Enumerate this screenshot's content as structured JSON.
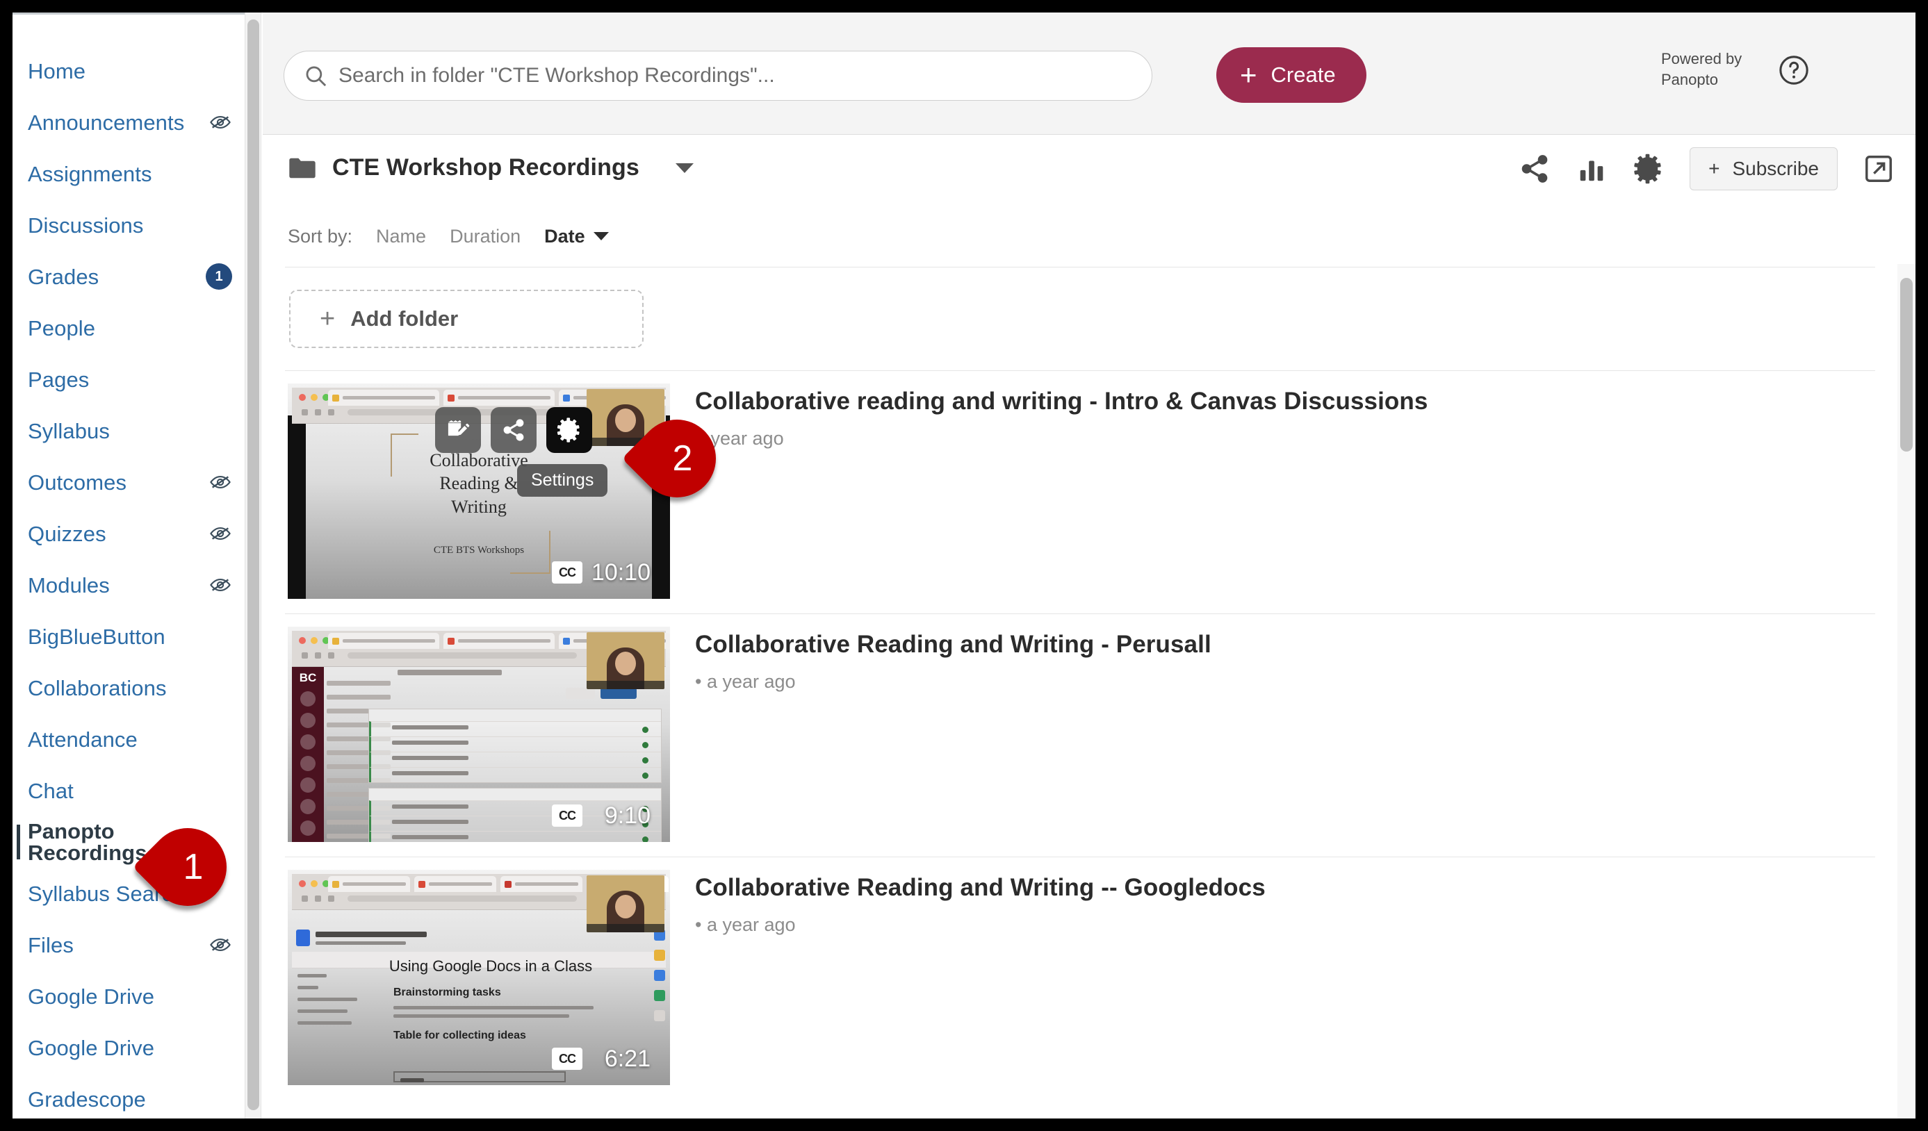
{
  "sidebar": {
    "items": [
      {
        "label": "Home",
        "hidden_icon": false,
        "badge": null,
        "active": false
      },
      {
        "label": "Announcements",
        "hidden_icon": true,
        "badge": null,
        "active": false
      },
      {
        "label": "Assignments",
        "hidden_icon": false,
        "badge": null,
        "active": false
      },
      {
        "label": "Discussions",
        "hidden_icon": false,
        "badge": null,
        "active": false
      },
      {
        "label": "Grades",
        "hidden_icon": false,
        "badge": "1",
        "active": false
      },
      {
        "label": "People",
        "hidden_icon": false,
        "badge": null,
        "active": false
      },
      {
        "label": "Pages",
        "hidden_icon": false,
        "badge": null,
        "active": false
      },
      {
        "label": "Syllabus",
        "hidden_icon": false,
        "badge": null,
        "active": false
      },
      {
        "label": "Outcomes",
        "hidden_icon": true,
        "badge": null,
        "active": false
      },
      {
        "label": "Quizzes",
        "hidden_icon": true,
        "badge": null,
        "active": false
      },
      {
        "label": "Modules",
        "hidden_icon": true,
        "badge": null,
        "active": false
      },
      {
        "label": "BigBlueButton",
        "hidden_icon": false,
        "badge": null,
        "active": false
      },
      {
        "label": "Collaborations",
        "hidden_icon": false,
        "badge": null,
        "active": false
      },
      {
        "label": "Attendance",
        "hidden_icon": false,
        "badge": null,
        "active": false
      },
      {
        "label": "Chat",
        "hidden_icon": false,
        "badge": null,
        "active": false
      },
      {
        "label": "Panopto Recordings",
        "hidden_icon": false,
        "badge": null,
        "active": true
      },
      {
        "label": "Syllabus Search",
        "hidden_icon": false,
        "badge": null,
        "active": false
      },
      {
        "label": "Files",
        "hidden_icon": true,
        "badge": null,
        "active": false
      },
      {
        "label": "Google Drive",
        "hidden_icon": false,
        "badge": null,
        "active": false
      },
      {
        "label": "Google Drive",
        "hidden_icon": false,
        "badge": null,
        "active": false
      },
      {
        "label": "Gradescope",
        "hidden_icon": false,
        "badge": null,
        "active": false
      }
    ]
  },
  "topbar": {
    "search_placeholder": "Search in folder \"CTE Workshop Recordings\"...",
    "create_label": "Create",
    "powered_by": "Powered by Panopto",
    "help_title": "Help"
  },
  "folder": {
    "name": "CTE Workshop Recordings",
    "subscribe_label": "Subscribe",
    "actions": [
      "share-icon",
      "stats-icon",
      "gear-icon",
      "subscribe-button",
      "open-external-icon"
    ]
  },
  "sort": {
    "label": "Sort by:",
    "options": [
      {
        "label": "Name",
        "active": false
      },
      {
        "label": "Duration",
        "active": false
      },
      {
        "label": "Date",
        "active": true
      }
    ]
  },
  "list": {
    "add_folder_label": "Add folder",
    "videos": [
      {
        "title": "Collaborative reading and writing - Intro & Canvas Discussions",
        "subtitle": "a year ago",
        "duration": "10:10",
        "cc": "CC",
        "thumb_kind": "slide",
        "thumb_text": {
          "title_line1": "Collaborative",
          "title_line2": "Reading &",
          "title_line3": "Writing",
          "footer": "CTE BTS Workshops"
        }
      },
      {
        "title": "Collaborative Reading and Writing - Perusall",
        "subtitle": "• a year ago",
        "duration": "9:10",
        "cc": "CC",
        "thumb_kind": "lms",
        "thumb_text": {
          "logo": "BC"
        }
      },
      {
        "title": "Collaborative Reading and Writing -- Googledocs",
        "subtitle": "• a year ago",
        "duration": "6:21",
        "cc": "CC",
        "thumb_kind": "gdocs",
        "thumb_text": {
          "doc_title": "Using Google Docs in a Class",
          "heading1": "Brainstorming tasks",
          "heading2": "Table for collecting ideas"
        }
      }
    ]
  },
  "hover_overlay": {
    "buttons": [
      "edit-icon",
      "share-icon",
      "settings-icon"
    ],
    "tooltip": "Settings"
  },
  "markers": [
    {
      "number": "1",
      "target": "Panopto Recordings sidebar link"
    },
    {
      "number": "2",
      "target": "Settings gear on video thumbnail"
    }
  ],
  "colors": {
    "accent_create": "#9b2b4e",
    "link_blue": "#2d6ca6",
    "marker_red": "#c00000",
    "active_text": "#2d3b45"
  }
}
